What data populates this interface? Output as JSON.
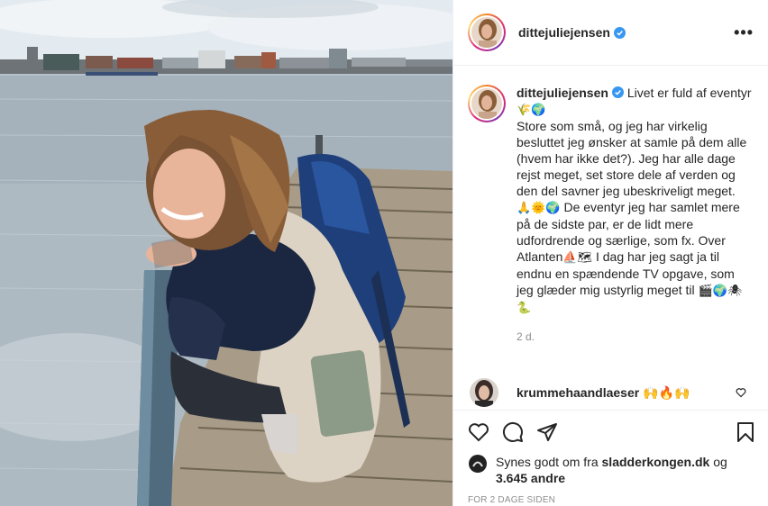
{
  "post": {
    "username": "dittejuliejensen",
    "caption_first": "Livet er fuld af eventyr",
    "caption_emoji_1": "🌾🌍",
    "caption_body": "Store som små, og jeg har virkelig besluttet jeg ønsker at samle på dem alle (hvem har ikke det?). Jeg har alle dage rejst meget, set store dele af verden og den del savner jeg ubeskriveligt meget.",
    "caption_emoji_2": "🙏🌞🌍",
    "caption_body_2": "De eventyr jeg har samlet mere på de sidste par, er de lidt mere udfordrende og særlige, som fx. Over Atlanten",
    "caption_emoji_3": "⛵🗺",
    "caption_body_3": "I dag har jeg sagt ja til endnu en spændende TV opgave, som jeg glæder mig ustyrlig meget til",
    "caption_emoji_4": "🎬🌍🕷🐍",
    "posted_ago": "2 d."
  },
  "comment": {
    "username": "krummehaandlaeser",
    "text": "🙌🔥🙌"
  },
  "likes": {
    "prefix": "Synes godt om fra",
    "by": "sladderkongen.dk",
    "joiner": "og",
    "others": "3.645 andre"
  },
  "date_label": "FOR 2 DAGE SIDEN",
  "icons": {
    "more": "more-options-icon",
    "like": "heart-icon",
    "comment": "comment-icon",
    "share": "share-icon",
    "save": "bookmark-icon"
  },
  "colors": {
    "verified": "#3897f0",
    "muted": "#8e8e8e",
    "text": "#262626"
  }
}
